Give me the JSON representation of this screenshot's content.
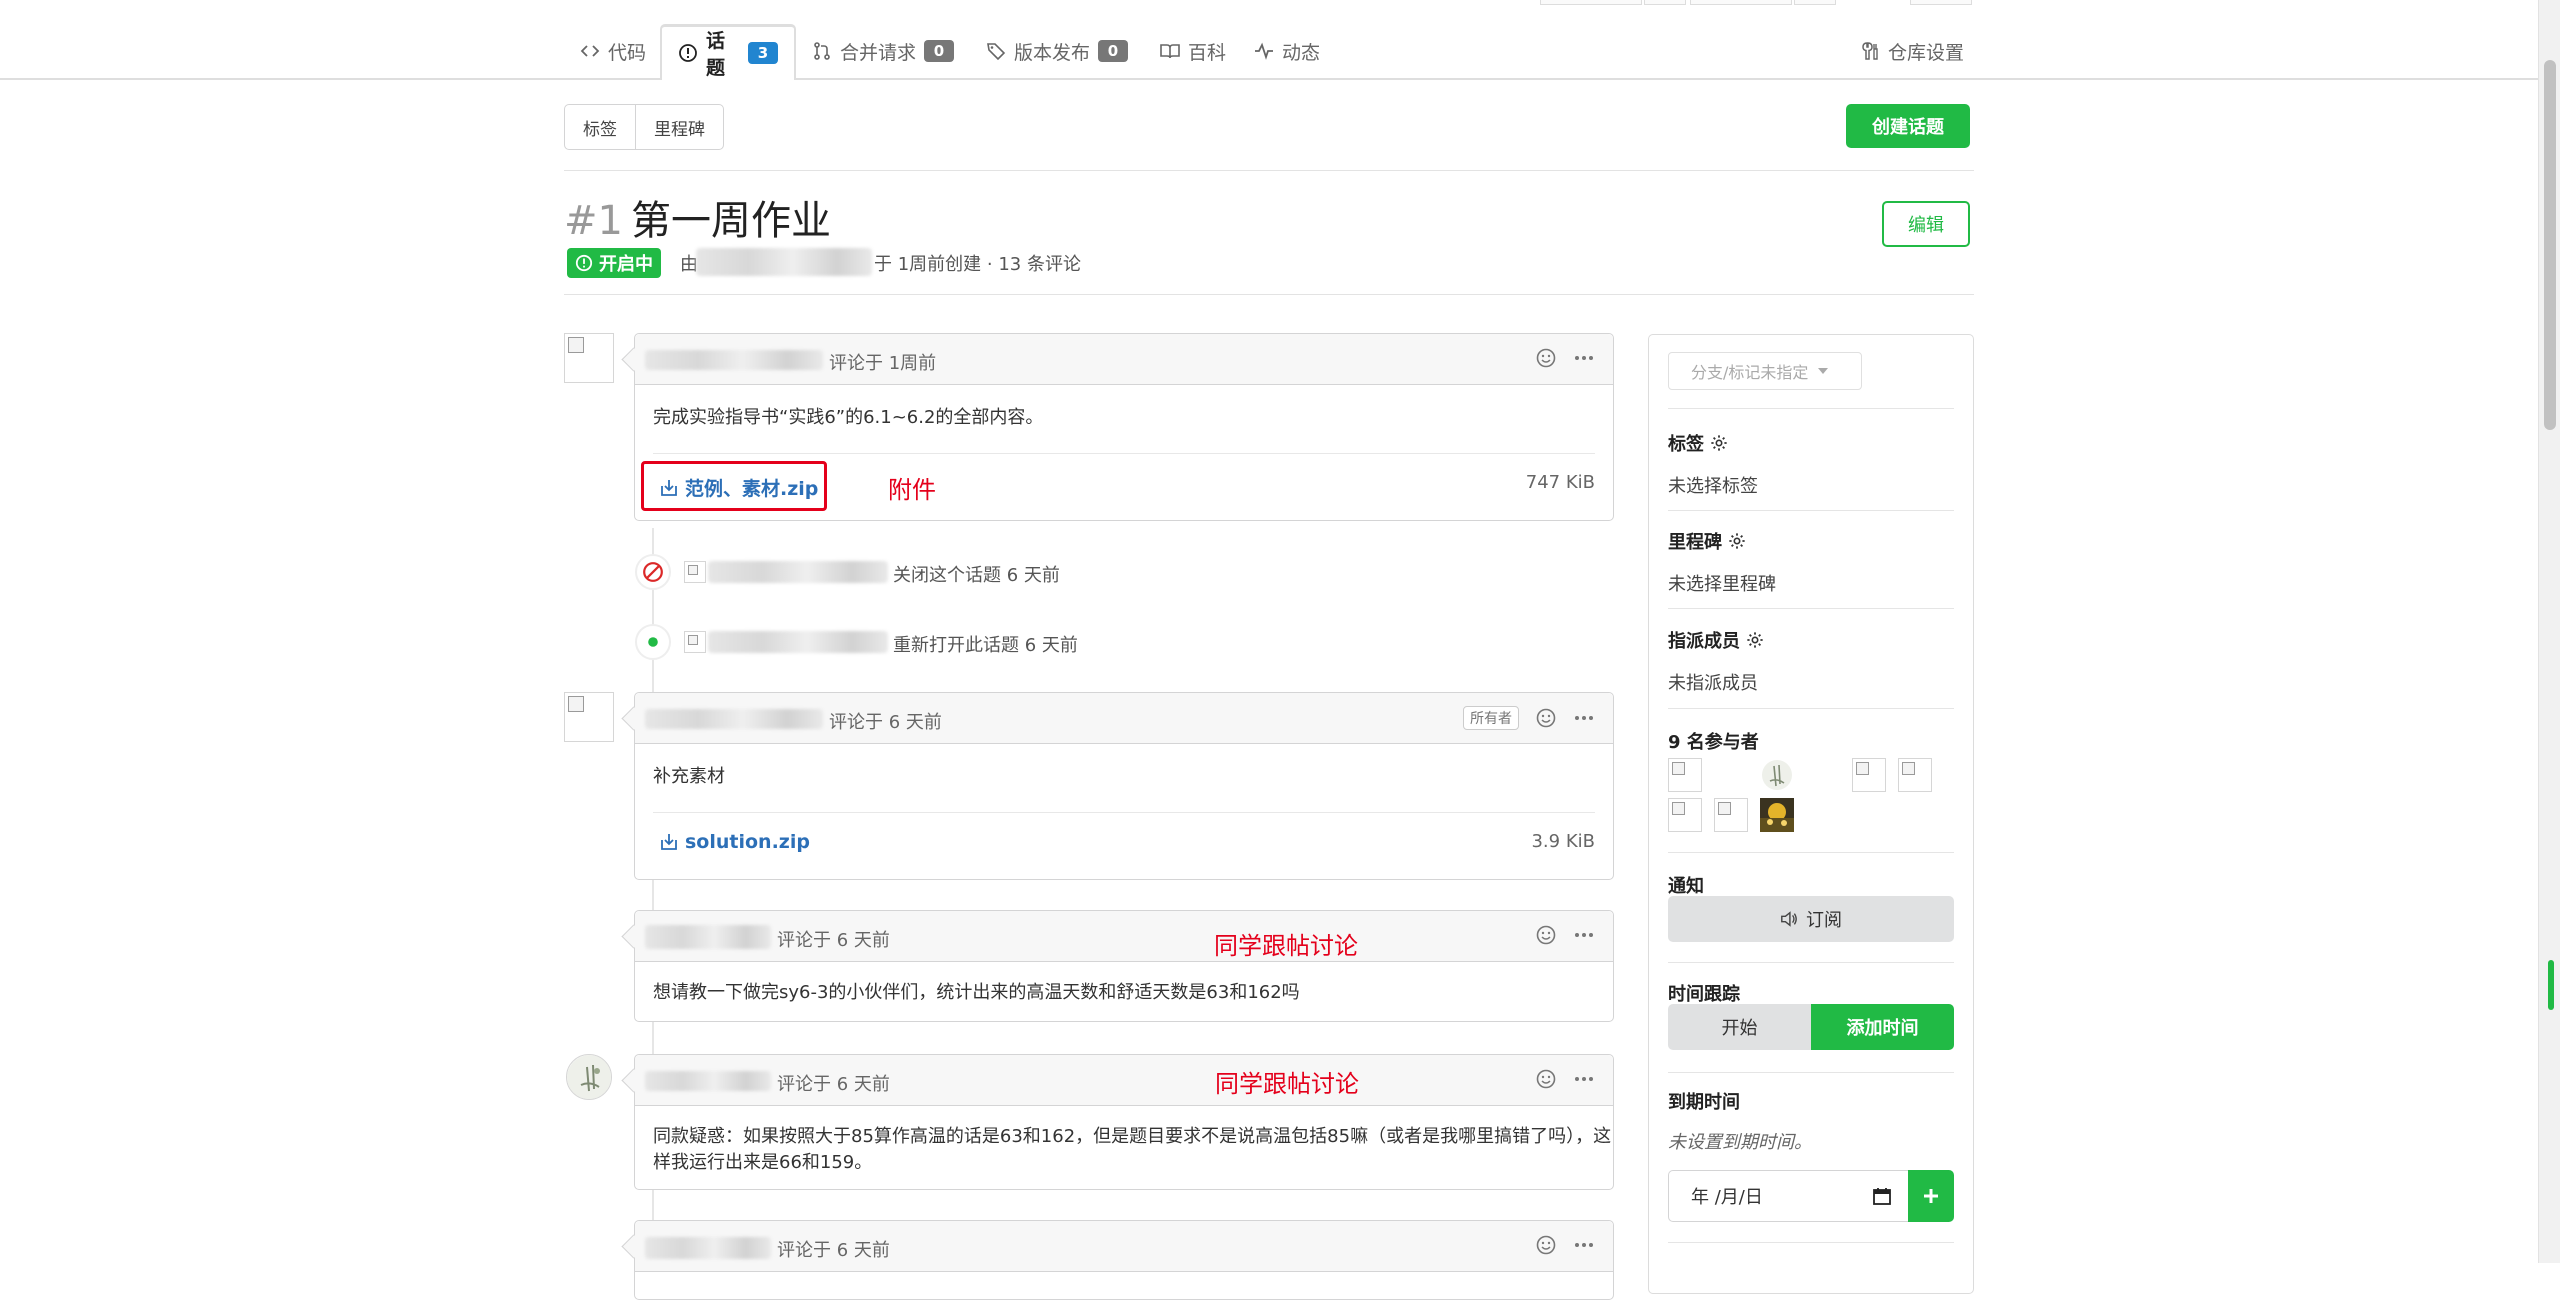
{
  "nav": {
    "tabs": [
      {
        "label": "代码"
      },
      {
        "label": "话题",
        "count": "3"
      },
      {
        "label": "合并请求",
        "count": "0"
      },
      {
        "label": "版本发布",
        "count": "0"
      },
      {
        "label": "百科"
      },
      {
        "label": "动态"
      }
    ],
    "settings_label": "仓库设置"
  },
  "toolbar": {
    "labels_button": "标签",
    "milestones_button": "里程碑",
    "new_issue_button": "创建话题"
  },
  "issue": {
    "number": "#1",
    "title": "第一周作业",
    "edit_button": "编辑",
    "state_label": "开启中",
    "meta_by": "由",
    "meta_rest": "于 1周前创建 · 13 条评论"
  },
  "comments": [
    {
      "meta": "评论于 1周前",
      "body": "完成实验指导书“实践6”的6.1~6.2的全部内容。",
      "attachment": "范例、素材.zip",
      "size": "747 KiB",
      "annotation": "附件"
    },
    {
      "meta": "评论于 6 天前",
      "owner_badge": "所有者",
      "body": "补充素材",
      "attachment": "solution.zip",
      "size": "3.9 KiB"
    },
    {
      "meta": "评论于 6 天前",
      "annotation": "同学跟帖讨论",
      "body": "想请教一下做完sy6-3的小伙伴们，统计出来的高温天数和舒适天数是63和162吗"
    },
    {
      "meta": "评论于 6 天前",
      "annotation": "同学跟帖讨论",
      "body_line1": "同款疑惑：如果按照大于85算作高温的话是63和162，但是题目要求不是说高温包括85嘛（或者是我哪里搞错了吗），这",
      "body_line2": "样我运行出来是66和159。"
    },
    {
      "meta": "评论于 6 天前"
    }
  ],
  "events": [
    {
      "text": "关闭这个话题 6 天前"
    },
    {
      "text": "重新打开此话题 6 天前"
    }
  ],
  "sidebar": {
    "branch_placeholder": "分支/标记未指定",
    "labels_title": "标签",
    "labels_value": "未选择标签",
    "milestone_title": "里程碑",
    "milestone_value": "未选择里程碑",
    "assignees_title": "指派成员",
    "assignees_value": "未指派成员",
    "participants_title": "9 名参与者",
    "notifications_title": "通知",
    "subscribe_button": "订阅",
    "time_tracking_title": "时间跟踪",
    "start_button": "开始",
    "add_time_button": "添加时间",
    "due_date_title": "到期时间",
    "due_date_value": "未设置到期时间。",
    "date_placeholder": "年 /月/日"
  },
  "colors": {
    "accent_green": "#21ba45",
    "badge_blue": "#2185d0",
    "link_blue": "#2c6fb7",
    "annotation_red": "#e4001b"
  }
}
